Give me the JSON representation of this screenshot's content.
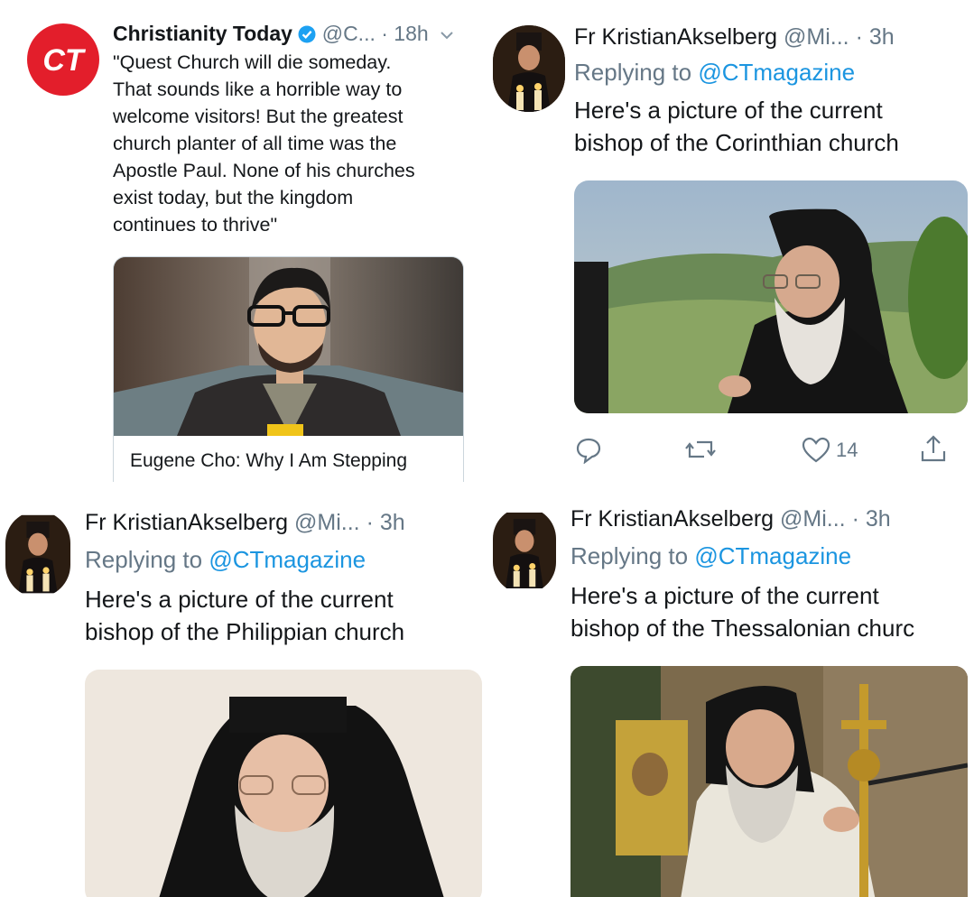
{
  "colors": {
    "link": "#1b95e0",
    "muted": "#657786",
    "verified": "#1da1f2",
    "ct_red": "#e31e2b"
  },
  "tweet_ct": {
    "logo_text": "CT",
    "name": "Christianity Today",
    "handle": "@C...",
    "dot_time": "· 18h",
    "lines": [
      "\"Quest Church will die someday.",
      "That sounds like a horrible way to",
      "welcome visitors! But the greatest",
      "church planter of all time was the",
      "Apostle Paul. None of his churches",
      "exist today, but the kingdom",
      "continues to thrive\""
    ],
    "card_title": "Eugene Cho: Why I Am Stepping"
  },
  "reply_corinth": {
    "name": "Fr KristianAkselberg",
    "handle": "@Mi...",
    "dot_time": "· 3h",
    "replying_prefix": "Replying to",
    "replying_handle": "@CTmagazine",
    "lines": [
      "Here's a picture of the current",
      "bishop of the Corinthian church"
    ],
    "like_count": "14",
    "actions": [
      "reply-icon",
      "retweet-icon",
      "like-icon",
      "share-icon"
    ]
  },
  "reply_philippi": {
    "name": "Fr KristianAkselberg",
    "handle": "@Mi...",
    "dot_time": "· 3h",
    "replying_prefix": "Replying to",
    "replying_handle": "@CTmagazine",
    "lines": [
      "Here's a picture of the current",
      "bishop of the Philippian church"
    ]
  },
  "reply_thessalonica": {
    "name": "Fr KristianAkselberg",
    "handle": "@Mi...",
    "dot_time": "· 3h",
    "replying_prefix": "Replying to",
    "replying_handle": "@CTmagazine",
    "lines": [
      "Here's a picture of the current",
      "bishop of the Thessalonian churc"
    ]
  }
}
